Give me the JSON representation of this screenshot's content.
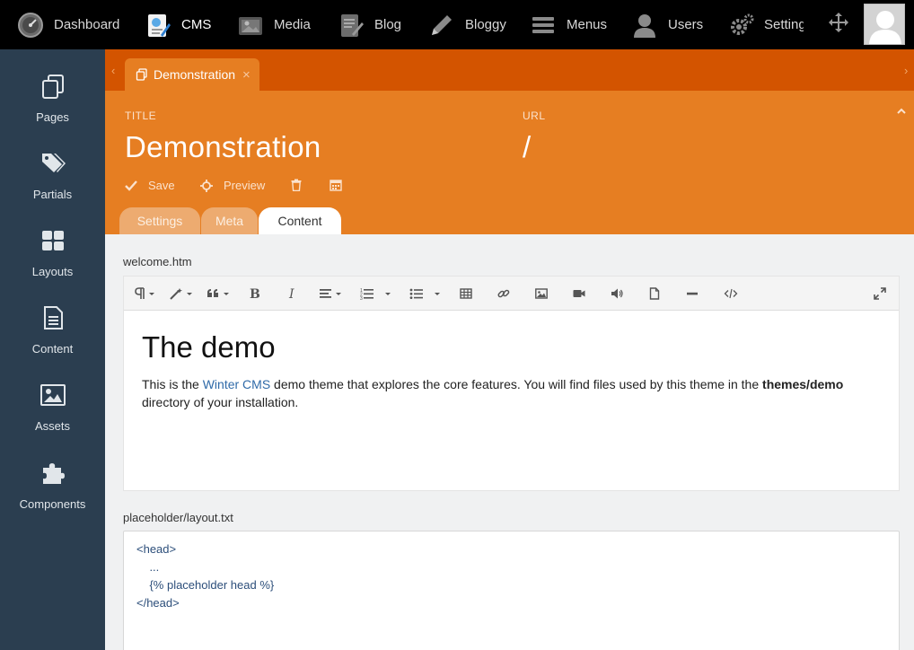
{
  "topnav": {
    "items": [
      {
        "label": "Dashboard",
        "icon": "dashboard-icon"
      },
      {
        "label": "CMS",
        "icon": "cms-icon"
      },
      {
        "label": "Media",
        "icon": "media-icon"
      },
      {
        "label": "Blog",
        "icon": "blog-icon"
      },
      {
        "label": "Bloggy",
        "icon": "pencil-icon"
      },
      {
        "label": "Menus",
        "icon": "menu-icon"
      },
      {
        "label": "Users",
        "icon": "user-icon"
      },
      {
        "label": "Settings",
        "icon": "gear-icon"
      }
    ]
  },
  "sidebar": {
    "items": [
      {
        "label": "Pages",
        "icon": "pages-icon"
      },
      {
        "label": "Partials",
        "icon": "tags-icon"
      },
      {
        "label": "Layouts",
        "icon": "layouts-icon"
      },
      {
        "label": "Content",
        "icon": "document-icon"
      },
      {
        "label": "Assets",
        "icon": "image-icon"
      },
      {
        "label": "Components",
        "icon": "puzzle-icon"
      }
    ]
  },
  "header": {
    "tab_label": "Demonstration",
    "title_label": "TITLE",
    "title_value": "Demonstration",
    "url_label": "URL",
    "url_value": "/",
    "save_label": "Save",
    "preview_label": "Preview",
    "subtabs": [
      "Settings",
      "Meta",
      "Content"
    ]
  },
  "content": {
    "file1_name": "welcome.htm",
    "heading": "The demo",
    "para_before": "This is the ",
    "para_link": "Winter CMS",
    "para_middle": " demo theme that explores the core features. You will find files used by this theme in the ",
    "para_bold": "themes/demo",
    "para_after": " directory of your installation.",
    "file2_name": "placeholder/layout.txt",
    "code_lines": [
      "<head>",
      "    ...",
      "    {% placeholder head %}",
      "</head>"
    ]
  },
  "colors": {
    "accent": "#e67e22",
    "accent_dark": "#d35400",
    "sidebar": "#2b3e50",
    "topbar": "#000000",
    "link": "#2f6aa8"
  }
}
